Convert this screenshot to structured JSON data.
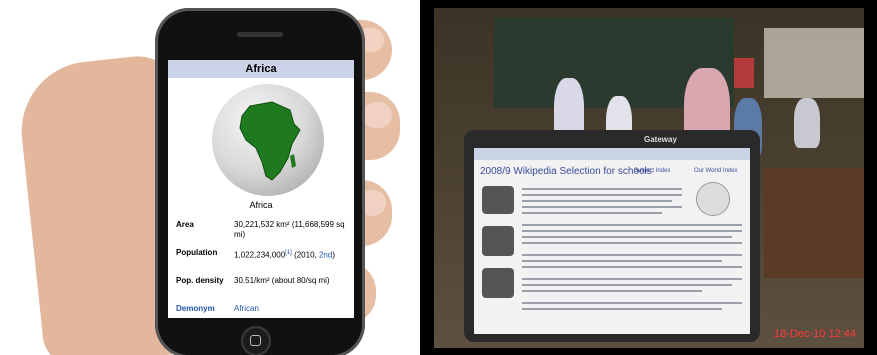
{
  "phone": {
    "title": "Africa",
    "caption": "Africa",
    "rows": {
      "area": {
        "label": "Area",
        "value": "30,221,532 km² (11,668,599 sq mi)"
      },
      "population": {
        "label": "Population",
        "value_prefix": "1,022,234,000",
        "ref": "[1]",
        "value_mid": " (2010, ",
        "rank": "2nd",
        "value_suffix": ")"
      },
      "density": {
        "label": "Pop. density",
        "value": "30.51/km² (about 80/sq mi)"
      },
      "demonym": {
        "label": "Demonym",
        "value": "African"
      }
    }
  },
  "laptop": {
    "brand": "Gateway",
    "page_title": "2008/9 Wikipedia Selection for schools",
    "subject_index": "Subject Index",
    "world_index": "Our World Index"
  },
  "photo": {
    "timestamp": "18-Dec-10 12:44"
  },
  "colors": {
    "infobox_header": "#ccd3e8",
    "link": "#2255aa",
    "africa": "#1f7a1f",
    "timestamp": "#ff3a3a"
  }
}
